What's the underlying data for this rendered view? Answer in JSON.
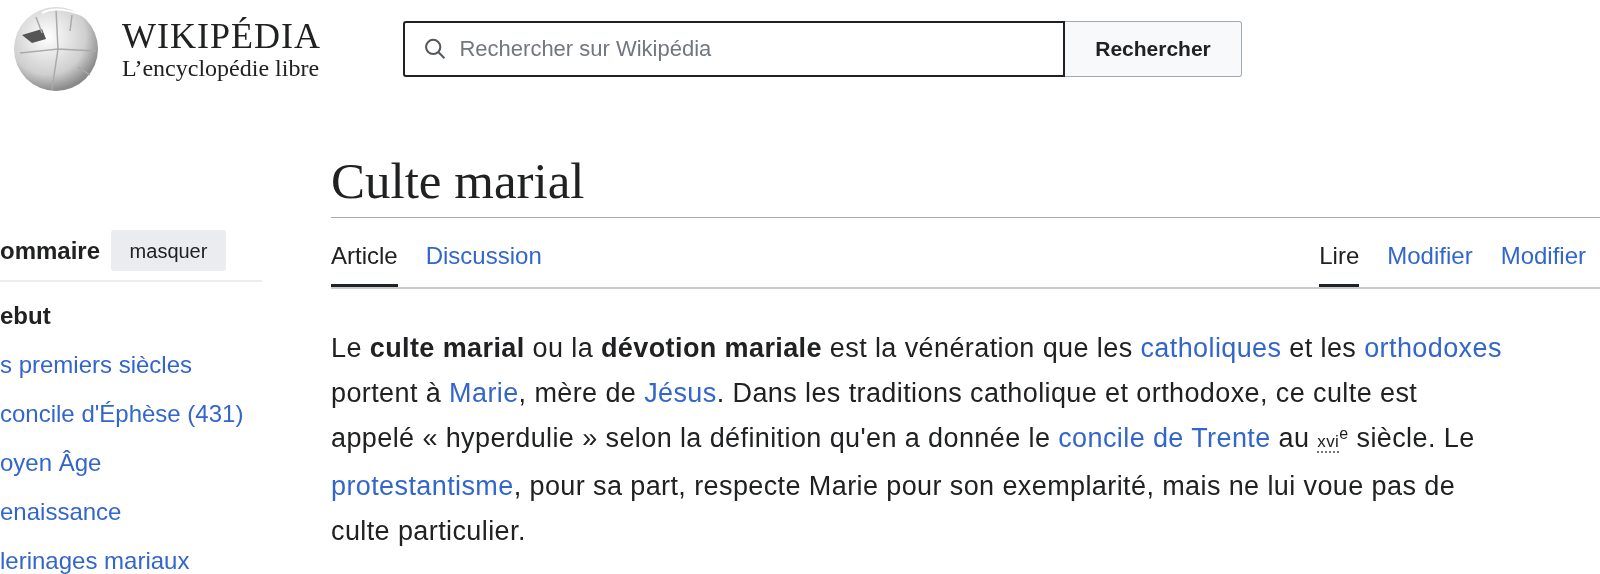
{
  "header": {
    "wordmark": "WIKIPÉDIA",
    "tagline": "L’encyclopédie libre",
    "search": {
      "placeholder": "Rechercher sur Wikipédia",
      "button": "Rechercher"
    }
  },
  "toc": {
    "title": "ommaire",
    "toggle": "masquer",
    "items": [
      {
        "label": "ebut",
        "kind": "top"
      },
      {
        "label": "s premiers siècles",
        "kind": "link"
      },
      {
        "label": "concile d'Éphèse (431)",
        "kind": "link"
      },
      {
        "label": "oyen Âge",
        "kind": "link"
      },
      {
        "label": "enaissance",
        "kind": "link"
      },
      {
        "label": "lerinages mariaux",
        "kind": "link"
      }
    ]
  },
  "article": {
    "title": "Culte marial",
    "tabs_left": [
      {
        "label": "Article",
        "selected": true
      },
      {
        "label": "Discussion",
        "selected": false
      }
    ],
    "tabs_right": [
      {
        "label": "Lire",
        "selected": true
      },
      {
        "label": "Modifier",
        "selected": false
      },
      {
        "label": "Modifier",
        "selected": false
      }
    ],
    "paragraph": [
      {
        "kind": "text",
        "text": "Le "
      },
      {
        "kind": "bold",
        "text": "culte marial"
      },
      {
        "kind": "text",
        "text": " ou la "
      },
      {
        "kind": "bold",
        "text": "dévotion mariale"
      },
      {
        "kind": "text",
        "text": " est la vénération que les "
      },
      {
        "kind": "link",
        "text": "catholiques"
      },
      {
        "kind": "text",
        "text": " et les "
      },
      {
        "kind": "link",
        "text": "orthodoxes"
      },
      {
        "kind": "text",
        "text": " portent à "
      },
      {
        "kind": "link",
        "text": "Marie"
      },
      {
        "kind": "text",
        "text": ", mère de "
      },
      {
        "kind": "link",
        "text": "Jésus"
      },
      {
        "kind": "text",
        "text": ". Dans les traditions catholique et orthodoxe, ce culte est appelé « hyperdulie » selon la définition qu'en a donnée le "
      },
      {
        "kind": "link",
        "text": "concile de Trente"
      },
      {
        "kind": "text",
        "text": " au "
      },
      {
        "kind": "abbr",
        "text": "xvi"
      },
      {
        "kind": "sup",
        "text": "e"
      },
      {
        "kind": "text",
        "text": " siècle. Le "
      },
      {
        "kind": "link",
        "text": "protestantisme"
      },
      {
        "kind": "text",
        "text": ", pour sa part, respecte Marie pour son exemplarité, mais ne lui voue pas de culte particulier."
      }
    ]
  }
}
